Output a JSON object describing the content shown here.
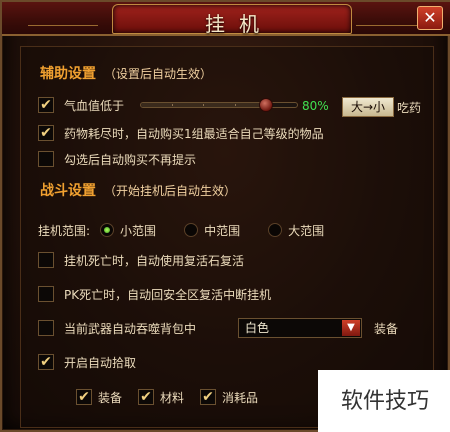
{
  "window": {
    "title": "挂机",
    "close_icon": "close-icon"
  },
  "assist": {
    "title": "辅助设置",
    "subtitle": "（设置后自动生效）",
    "hp_label": "气血值低于",
    "hp_percent": "80%",
    "hp_level": 0.8,
    "order_button": "大→小",
    "eat_label": "吃药",
    "auto_buy_label": "药物耗尽时，自动购买1组最适合自己等级的物品",
    "no_prompt_label": "勾选后自动购买不再提示",
    "hp_checked": true,
    "auto_buy_checked": true,
    "no_prompt_checked": false
  },
  "combat": {
    "title": "战斗设置",
    "subtitle": "（开始挂机后自动生效）",
    "range_label": "挂机范围:",
    "ranges": [
      "小范围",
      "中范围",
      "大范围"
    ],
    "selected_range": 0,
    "revive_label": "挂机死亡时，自动使用复活石复活",
    "pk_label": "PK死亡时，自动回安全区复活中断挂机",
    "devour_label": "当前武器自动吞噬背包中",
    "devour_select": "白色",
    "devour_suffix": "装备",
    "pickup_label": "开启自动拾取",
    "revive_checked": false,
    "pk_checked": false,
    "devour_checked": false,
    "pickup_checked": true
  },
  "loot": {
    "items": [
      "装备",
      "材料",
      "消耗品"
    ],
    "checked": [
      true,
      true,
      true
    ]
  },
  "watermark": "软件技巧"
}
